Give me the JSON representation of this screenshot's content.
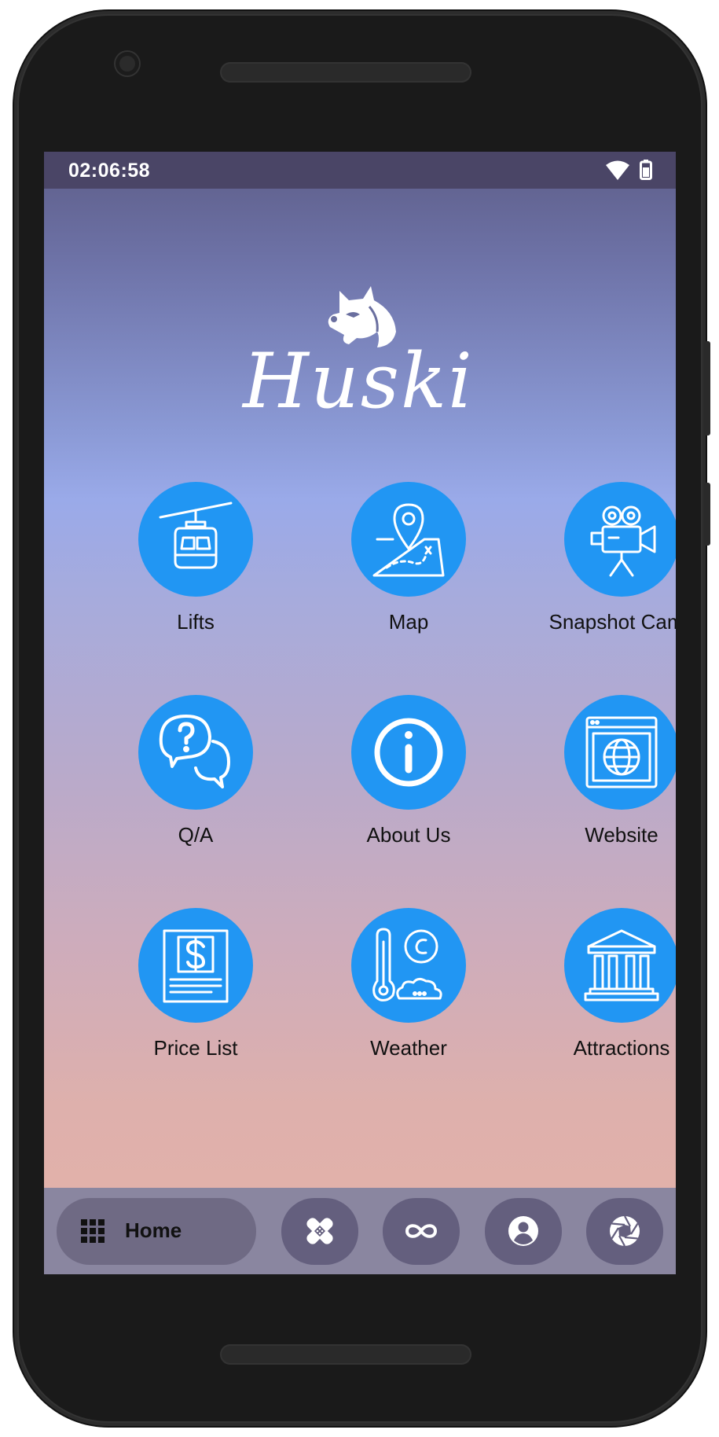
{
  "status_bar": {
    "time": "02:06:58",
    "wifi_icon": "wifi-icon",
    "battery_icon": "battery-icon"
  },
  "app": {
    "name": "Huski",
    "logo_icon": "husky-dog-icon"
  },
  "tiles": [
    {
      "label": "Lifts",
      "icon": "gondola-lift-icon"
    },
    {
      "label": "Map",
      "icon": "map-pin-icon"
    },
    {
      "label": "Snapshot Cams",
      "icon": "video-camera-icon"
    },
    {
      "label": "Q/A",
      "icon": "question-chat-icon"
    },
    {
      "label": "About Us",
      "icon": "info-icon"
    },
    {
      "label": "Website",
      "icon": "globe-browser-icon"
    },
    {
      "label": "Price List",
      "icon": "price-document-icon"
    },
    {
      "label": "Weather",
      "icon": "thermometer-cloud-icon"
    },
    {
      "label": "Attractions",
      "icon": "museum-building-icon"
    }
  ],
  "bottom_nav": {
    "home_label": "Home",
    "home_icon": "grid-icon",
    "buttons": [
      "bandage-icon",
      "infinity-icon",
      "account-icon",
      "camera-shutter-icon"
    ]
  },
  "colors": {
    "accent": "#2196f3",
    "status_bar": "#4a4566",
    "nav_bar": "#8a86a0",
    "nav_pill": "#6f6a84"
  }
}
